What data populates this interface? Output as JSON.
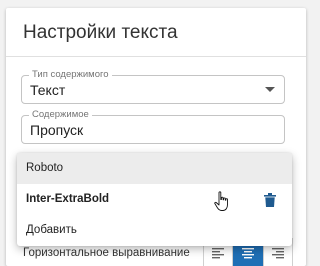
{
  "panel": {
    "title": "Настройки текста"
  },
  "content_type": {
    "label": "Тип содержимого",
    "value": "Текст",
    "icon": "chevron-down-icon"
  },
  "content": {
    "label": "Содержимое",
    "value": "Пропуск"
  },
  "font_menu": {
    "options": [
      {
        "label": "Roboto",
        "hovered": true
      },
      {
        "label": "Inter-ExtraBold",
        "bold": true,
        "delete_icon": "trash-icon"
      },
      {
        "label": "Добавить"
      }
    ]
  },
  "horizontal_alignment": {
    "label": "Горизонтальное выравнивание",
    "options": [
      {
        "icon": "align-left-icon",
        "selected": false
      },
      {
        "icon": "align-center-icon",
        "selected": true
      },
      {
        "icon": "align-right-icon",
        "selected": false
      }
    ]
  },
  "colors": {
    "accent": "#1f6fb5",
    "trash": "#1f5a8f"
  }
}
